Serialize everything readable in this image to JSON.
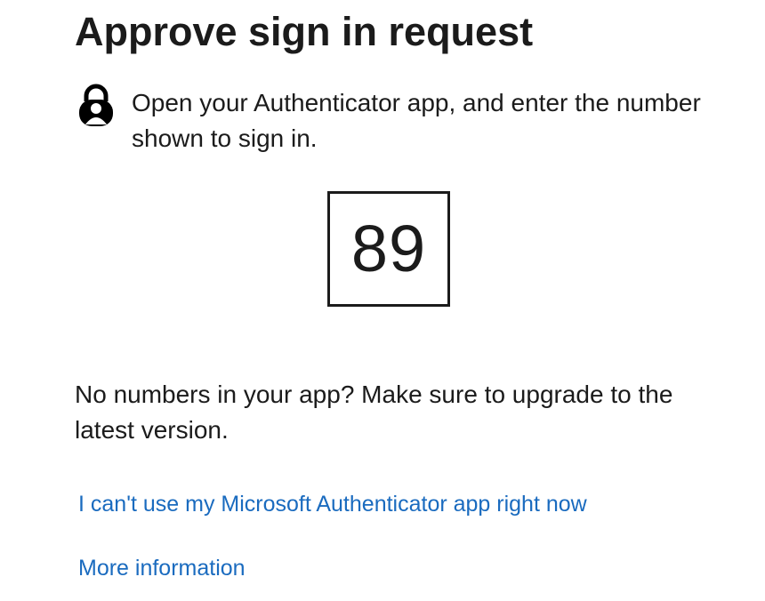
{
  "header": {
    "title": "Approve sign in request"
  },
  "instruction": {
    "icon": "authenticator-lock-icon",
    "text": "Open your Authenticator app, and enter the number shown to sign in."
  },
  "code": {
    "number": "89"
  },
  "upgrade_notice": {
    "text": "No numbers in your app? Make sure to upgrade to the latest version."
  },
  "links": {
    "cant_use_app": "I can't use my Microsoft Authenticator app right now",
    "more_information": "More information"
  },
  "colors": {
    "link": "#1a6bbf",
    "text": "#1b1b1b",
    "background": "#ffffff"
  }
}
